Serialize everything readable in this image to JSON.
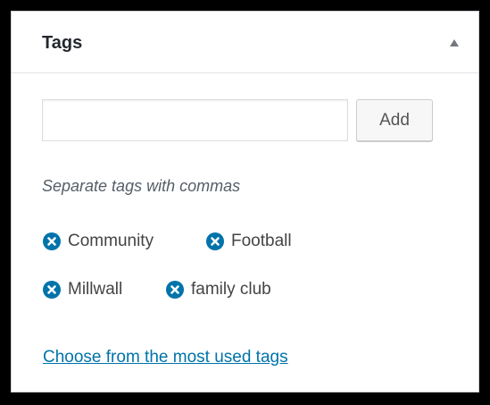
{
  "panel": {
    "title": "Tags",
    "toggle_icon": "triangle-up-icon"
  },
  "new_tag": {
    "value": "",
    "placeholder": "",
    "add_label": "Add",
    "hint": "Separate tags with commas"
  },
  "tags": [
    {
      "label": "Community",
      "remove_icon": "remove-circle-icon"
    },
    {
      "label": "Football",
      "remove_icon": "remove-circle-icon"
    },
    {
      "label": "Millwall",
      "remove_icon": "remove-circle-icon"
    },
    {
      "label": "family club",
      "remove_icon": "remove-circle-icon"
    }
  ],
  "most_used_link": "Choose from the most used tags",
  "colors": {
    "accent": "#0073aa",
    "remove_icon": "#0073aa",
    "text": "#444444",
    "background": "#000000"
  }
}
